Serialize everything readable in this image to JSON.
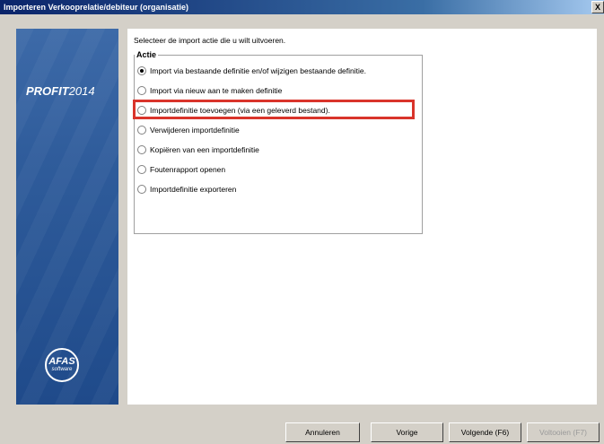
{
  "window": {
    "title": "Importeren Verkooprelatie/debiteur (organisatie)",
    "close_glyph": "X"
  },
  "brand": {
    "product_bold": "PROFIT",
    "product_year": "2014",
    "logo_main": "AFAS",
    "logo_sub": "software"
  },
  "main": {
    "instruction": "Selecteer de import actie die u wilt uitvoeren.",
    "group_label": "Actie",
    "options": [
      {
        "label": "Import via bestaande definitie en/of wijzigen bestaande definitie.",
        "checked": true
      },
      {
        "label": "Import via nieuw aan te maken definitie",
        "checked": false
      },
      {
        "label": "Importdefinitie toevoegen (via een geleverd bestand).",
        "checked": false
      },
      {
        "label": "Verwijderen importdefinitie",
        "checked": false
      },
      {
        "label": "Kopiëren van een importdefinitie",
        "checked": false
      },
      {
        "label": "Foutenrapport openen",
        "checked": false
      },
      {
        "label": "Importdefinitie exporteren",
        "checked": false
      }
    ]
  },
  "buttons": {
    "cancel": "Annuleren",
    "previous": "Vorige",
    "next": "Volgende (F6)",
    "finish": "Voltooien (F7)"
  },
  "colors": {
    "highlight": "#d9342b",
    "brand_panel": "#2f5c9b"
  }
}
